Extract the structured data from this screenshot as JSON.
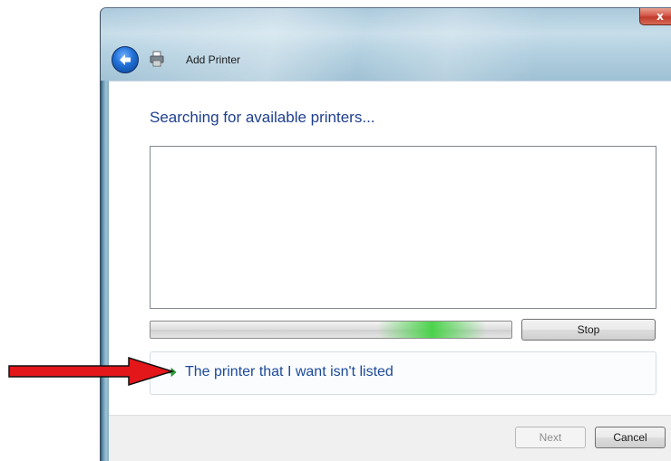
{
  "window": {
    "title": "Add Printer",
    "close_glyph": "x"
  },
  "main": {
    "heading": "Searching for available printers...",
    "printers": [],
    "progress": {
      "state": "indeterminate-searching",
      "glow_position_pct": 78
    },
    "stop_label": "Stop",
    "not_listed_link": "The printer that I want isn't listed"
  },
  "footer": {
    "next_label": "Next",
    "next_enabled": false,
    "cancel_label": "Cancel"
  },
  "annotation": {
    "arrow_color": "#e3161a",
    "points_to": "not_listed_link"
  },
  "icons": {
    "back": "back-arrow-icon",
    "printer": "printer-icon",
    "close": "close-icon",
    "link_arrow": "green-arrow-icon"
  }
}
